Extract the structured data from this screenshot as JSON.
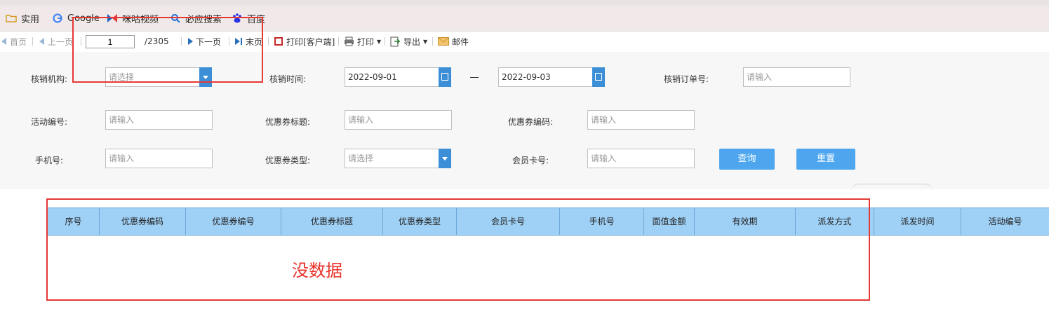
{
  "bookmarks": [
    {
      "label": "实用",
      "icon": "folder-icon"
    },
    {
      "label": "Google",
      "icon": "google-icon"
    },
    {
      "label": "咪咕视频",
      "icon": "migu-icon"
    },
    {
      "label": "必应搜索",
      "icon": "bing-search-icon"
    },
    {
      "label": "百度",
      "icon": "baidu-icon"
    }
  ],
  "toolbar": {
    "first": "首页",
    "prev": "上一页",
    "page_value": "1",
    "total": "/2305",
    "next": "下一页",
    "last": "末页",
    "print_client": "打印[客户端]",
    "print": "打印",
    "export": "导出",
    "mail": "邮件"
  },
  "filters": {
    "org_label": "核销机构:",
    "org_placeholder": "请选择",
    "time_label": "核销时间:",
    "time_from": "2022-09-01",
    "time_to": "2022-09-03",
    "order_label": "核销订单号:",
    "order_placeholder": "请输入",
    "activity_label": "活动编号:",
    "activity_placeholder": "请输入",
    "title_label": "优惠券标题:",
    "title_placeholder": "请输入",
    "code_label": "优惠券编码:",
    "code_placeholder": "请输入",
    "phone_label": "手机号:",
    "phone_placeholder": "请输入",
    "type_label": "优惠券类型:",
    "type_placeholder": "请选择",
    "card_label": "会员卡号:",
    "card_placeholder": "请输入",
    "query": "查询",
    "reset": "重置"
  },
  "table": {
    "columns": [
      "序号",
      "优惠券编码",
      "优惠券编号",
      "优惠券标题",
      "优惠券类型",
      "会员卡号",
      "手机号",
      "面值金额",
      "有效期",
      "派发方式",
      "派发时间",
      "活动编号"
    ],
    "empty_text": "没数据"
  },
  "colors": {
    "accent": "#4da6ee",
    "header": "#9fd0f5",
    "annotation": "#e53935"
  }
}
